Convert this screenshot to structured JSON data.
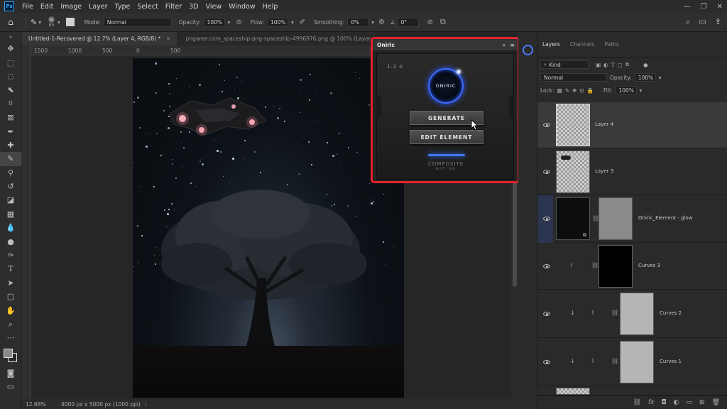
{
  "app": {
    "logo": "Ps",
    "menu": [
      "File",
      "Edit",
      "Image",
      "Layer",
      "Type",
      "Select",
      "Filter",
      "3D",
      "View",
      "Window",
      "Help"
    ]
  },
  "options_bar": {
    "brush_size": "85",
    "mode_label": "Mode:",
    "mode_value": "Normal",
    "opacity_label": "Opacity:",
    "opacity_value": "100%",
    "flow_label": "Flow:",
    "flow_value": "100%",
    "smoothing_label": "Smoothing:",
    "smoothing_value": "0%",
    "angle_value": "0°"
  },
  "tabs": [
    {
      "label": "Untitled-1-Recovered @ 12.7% (Layer 4, RGB/8) *",
      "active": true
    },
    {
      "label": "pngarea.com_spaceship-png-spaceship-4996976.png @ 100% (Layer",
      "active": false
    }
  ],
  "ruler": {
    "ticks": [
      "1500",
      "1000",
      "500",
      "0",
      "500"
    ]
  },
  "status": {
    "zoom": "12.68%",
    "doc_size": "4000 px x 5000 px (1000 ppi)"
  },
  "plugin": {
    "title": "Oniric",
    "version": "1.2.0",
    "logo_text": "ONIRIC",
    "generate_label": "GENERATE",
    "edit_label": "EDIT ELEMENT",
    "brand_line1": "COMPOSITE",
    "brand_line2": "NATION",
    "accent_color": "#3d6cff",
    "highlight_color": "#e3232e"
  },
  "layers_panel": {
    "tabs": [
      "Layers",
      "Channels",
      "Paths"
    ],
    "filter_label": "Kind",
    "blend_mode": "Normal",
    "opacity_label": "Opacity:",
    "opacity_value": "100%",
    "lock_label": "Lock:",
    "fill_label": "Fill:",
    "fill_value": "100%",
    "layers": [
      {
        "name": "Layer 4",
        "selected": true
      },
      {
        "name": "Layer 3",
        "selected": false
      },
      {
        "name": "Oniric_Element - glow",
        "selected": false
      },
      {
        "name": "Curves 3",
        "selected": false
      },
      {
        "name": "Curves 2",
        "selected": false
      },
      {
        "name": "Curves 1",
        "selected": false
      }
    ]
  }
}
